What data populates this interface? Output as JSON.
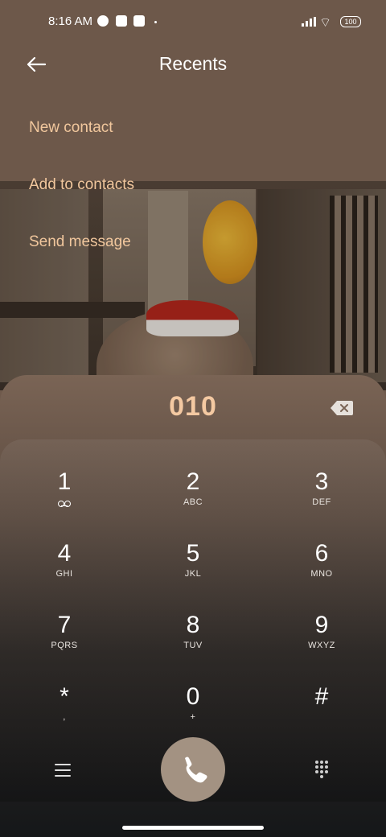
{
  "status_bar": {
    "time": "8:16 AM",
    "battery": "100"
  },
  "header": {
    "title": "Recents"
  },
  "options": [
    {
      "label": "New contact"
    },
    {
      "label": "Add to contacts"
    },
    {
      "label": "Send message"
    }
  ],
  "dialer": {
    "number": "010",
    "keys": [
      {
        "digit": "1",
        "letters": ""
      },
      {
        "digit": "2",
        "letters": "ABC"
      },
      {
        "digit": "3",
        "letters": "DEF"
      },
      {
        "digit": "4",
        "letters": "GHI"
      },
      {
        "digit": "5",
        "letters": "JKL"
      },
      {
        "digit": "6",
        "letters": "MNO"
      },
      {
        "digit": "7",
        "letters": "PQRS"
      },
      {
        "digit": "8",
        "letters": "TUV"
      },
      {
        "digit": "9",
        "letters": "WXYZ"
      },
      {
        "digit": "*",
        "letters": ","
      },
      {
        "digit": "0",
        "letters": "+"
      },
      {
        "digit": "#",
        "letters": ""
      }
    ],
    "icons": {
      "back": "back-arrow-icon",
      "backspace": "backspace-icon",
      "menu": "menu-icon",
      "call": "phone-icon",
      "keypad_toggle": "keypad-grid-icon"
    },
    "accent_color": "#f1c79d"
  }
}
